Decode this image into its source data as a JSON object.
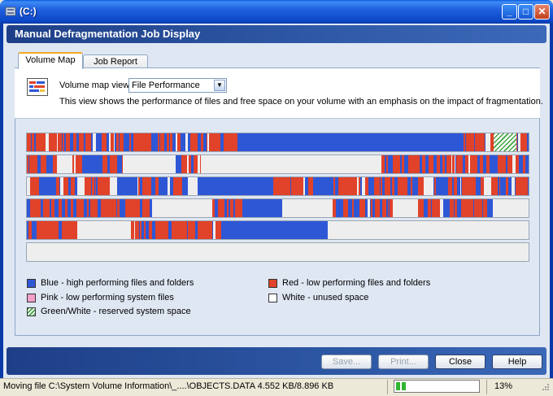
{
  "window": {
    "title": "(C:)"
  },
  "header": {
    "title": "Manual Defragmentation Job Display"
  },
  "tabs": [
    {
      "label": "Volume Map",
      "active": true
    },
    {
      "label": "Job Report",
      "active": false
    }
  ],
  "volume_map": {
    "view_label": "Volume map view:",
    "view_selected": "File Performance",
    "description": "This view shows the performance of files and free space on your volume with an emphasis on the impact of fragmentation.",
    "colors": {
      "blue": "#2e57d6",
      "red": "#e0422a",
      "white": "#efeeee",
      "green": "#3fa33f"
    },
    "rows": [
      {
        "pattern": [
          [
            "m",
            0.42
          ],
          [
            "b",
            0.45
          ],
          [
            "m",
            0.06
          ],
          [
            "g",
            0.045
          ],
          [
            "m",
            0.025
          ]
        ]
      },
      {
        "pattern": [
          [
            "m",
            0.06
          ],
          [
            "w",
            0.03
          ],
          [
            "m",
            0.02
          ],
          [
            "b",
            0.04
          ],
          [
            "m",
            0.045
          ],
          [
            "w",
            0.1
          ],
          [
            "m",
            0.05
          ],
          [
            "w",
            0.36
          ],
          [
            "m",
            0.345
          ]
        ]
      },
      {
        "pattern": [
          [
            "m",
            0.1
          ],
          [
            "w",
            0.015
          ],
          [
            "m",
            0.05
          ],
          [
            "w",
            0.015
          ],
          [
            "b",
            0.04
          ],
          [
            "m",
            0.1
          ],
          [
            "w",
            0.02
          ],
          [
            "b",
            0.15
          ],
          [
            "m",
            0.08
          ],
          [
            "b",
            0.04
          ],
          [
            "m",
            0.18
          ],
          [
            "w",
            0.02
          ],
          [
            "m",
            0.1
          ],
          [
            "w",
            0.015
          ],
          [
            "m",
            0.075
          ]
        ]
      },
      {
        "pattern": [
          [
            "m",
            0.25
          ],
          [
            "w",
            0.12
          ],
          [
            "m",
            0.06
          ],
          [
            "b",
            0.08
          ],
          [
            "w",
            0.1
          ],
          [
            "m",
            0.12
          ],
          [
            "w",
            0.05
          ],
          [
            "m",
            0.15
          ],
          [
            "w",
            0.07
          ]
        ]
      },
      {
        "pattern": [
          [
            "m",
            0.1
          ],
          [
            "w",
            0.1
          ],
          [
            "m",
            0.2
          ],
          [
            "b",
            0.2
          ],
          [
            "w",
            0.4
          ]
        ]
      },
      {
        "pattern": [
          [
            "w",
            1.0
          ]
        ]
      }
    ]
  },
  "legend": [
    {
      "label": "Blue - high performing files and folders",
      "color": "#2e57d6",
      "pattern": "solid"
    },
    {
      "label": "Red - low performing files and folders",
      "color": "#e0422a",
      "pattern": "solid"
    },
    {
      "label": "Pink - low performing system files",
      "color": "#f4a0c8",
      "pattern": "solid"
    },
    {
      "label": "White - unused space",
      "color": "#ffffff",
      "pattern": "solid"
    },
    {
      "label": "Green/White - reserved system space",
      "color": "#3fa33f",
      "pattern": "hatch"
    }
  ],
  "buttons": {
    "save": "Save...",
    "print": "Print...",
    "close": "Close",
    "help": "Help"
  },
  "status": {
    "text": "Moving file C:\\System Volume Information\\_....\\OBJECTS.DATA  4.552 KB/8.896 KB",
    "progress": 0.13,
    "percent": "13%"
  }
}
